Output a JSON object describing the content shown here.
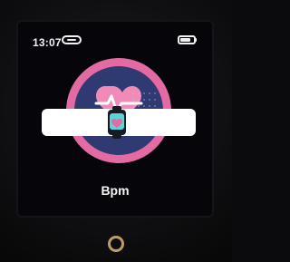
{
  "status_bar": {
    "time": "13:07",
    "link_icon": "link-icon",
    "battery_icon": "battery-icon"
  },
  "main": {
    "label": "Bpm",
    "medallion_colors": {
      "ring": "#e36aa3",
      "inner": "#2f3a73"
    },
    "icons": {
      "heart": "heart-icon",
      "pulse": "pulse-line-icon",
      "watch": "watch-icon"
    }
  },
  "device": {
    "home_button": "home-button"
  }
}
